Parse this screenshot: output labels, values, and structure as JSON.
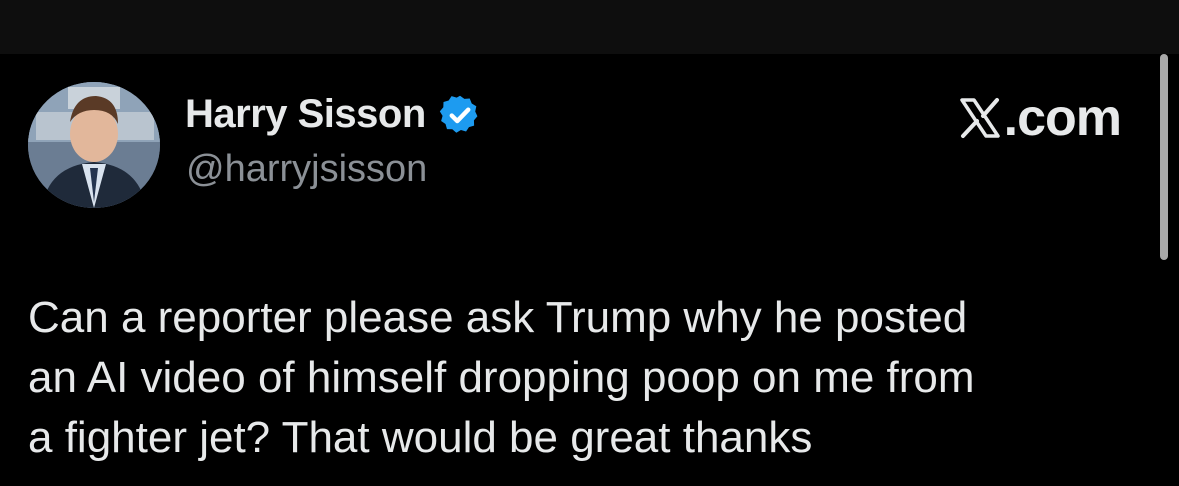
{
  "author": {
    "name": "Harry Sisson",
    "handle": "@harryjsisson",
    "verified_icon": "verified-badge-icon"
  },
  "brand": {
    "logo_icon": "x-logo-icon",
    "label": ".com"
  },
  "tweet": {
    "lines": [
      "Can a reporter please ask Trump why he posted",
      "an AI video of himself dropping poop on me from",
      "a fighter jet? That would be great thanks"
    ]
  },
  "colors": {
    "background": "#000000",
    "text": "#e7e9ea",
    "secondary_text": "#8b9096",
    "verified_blue": "#1d9bf0"
  }
}
